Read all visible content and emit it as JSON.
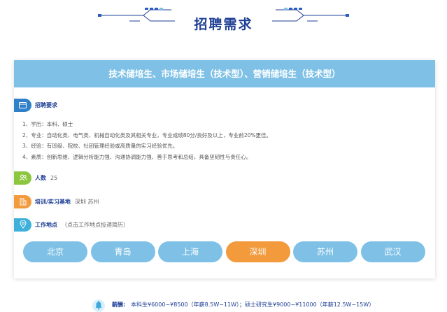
{
  "page": {
    "title": "招聘需求"
  },
  "card": {
    "title": "技术储培生、市场储培生（技术型）、营销储培生（技术型）"
  },
  "requirements": {
    "label": "招聘要求",
    "icon": "card-icon",
    "lines": [
      "1、学历：本科、硕士",
      "2、专业：自动化类、电气类、机械自动化类及其相关专业，专业成绩80分/良好及以上，专业前20%更佳。",
      "3、经验：有班级、院校、社团管理经验或高质量的实习经验优先。",
      "4、素质：创新思维、逻辑分析能力强、沟通协调能力强、善于思考和总结，具备坚韧性与责任心。"
    ]
  },
  "headcount": {
    "label": "人数",
    "value": "25",
    "icon": "people-icon"
  },
  "training": {
    "label": "培训/实习基地",
    "value": "深圳  苏州",
    "icon": "building-icon"
  },
  "location": {
    "label": "工作地点",
    "hint": "（点击工作地点投递简历）",
    "icon": "location-pin-icon"
  },
  "cities": [
    {
      "label": "北京",
      "active": false
    },
    {
      "label": "青岛",
      "active": false
    },
    {
      "label": "上海",
      "active": false
    },
    {
      "label": "深圳",
      "active": true
    },
    {
      "label": "苏州",
      "active": false
    },
    {
      "label": "武汉",
      "active": false
    }
  ],
  "salary": {
    "label": "薪酬:",
    "text": "本科生¥6000~¥8500（年薪8.5W~11W）；硕士研究生¥9000~¥11000（年薪12.5W~15W）",
    "icon": "bell-icon"
  },
  "colors": {
    "accent_blue": "#7fc1e6",
    "title_navy": "#1e3f94",
    "active_orange": "#f39a3c",
    "headcount_green": "#8cc63f",
    "training_orange": "#f39a3c"
  }
}
